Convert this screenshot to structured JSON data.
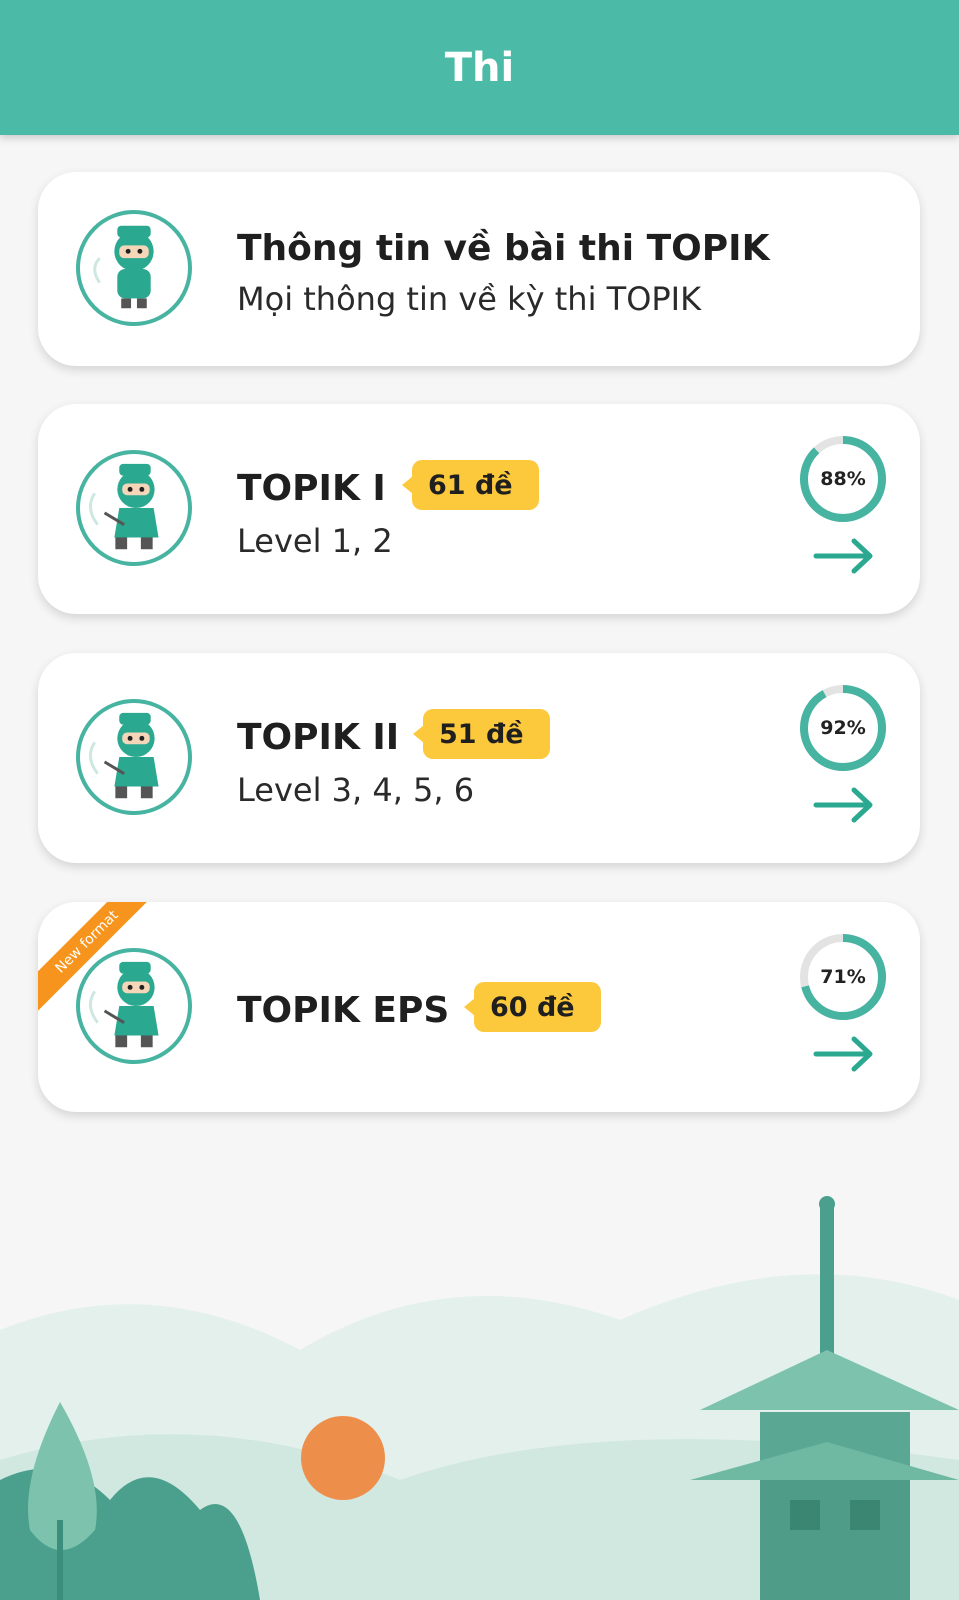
{
  "header": {
    "title": "Thi"
  },
  "colors": {
    "header": "#4bbaa6",
    "accent": "#2aa890",
    "badge": "#fcc93d",
    "ribbon": "#f7941d"
  },
  "info_card": {
    "title": "Thông tin về bài thi TOPIK",
    "subtitle": "Mọi thông tin về kỳ thi TOPIK",
    "icon": "ninja-mascot-icon"
  },
  "exams": [
    {
      "title": "TOPIK I",
      "subtitle": "Level 1, 2",
      "badge": "61 đề",
      "progress_label": "88%",
      "progress": 88,
      "icon": "ninja-mascot-icon"
    },
    {
      "title": "TOPIK II",
      "subtitle": "Level 3, 4, 5, 6",
      "badge": "51 đề",
      "progress_label": "92%",
      "progress": 92,
      "icon": "ninja-mascot-icon"
    },
    {
      "title": "TOPIK EPS",
      "subtitle": "",
      "badge": "60 đề",
      "progress_label": "71%",
      "progress": 71,
      "ribbon": "New format",
      "icon": "ninja-mascot-icon"
    }
  ]
}
